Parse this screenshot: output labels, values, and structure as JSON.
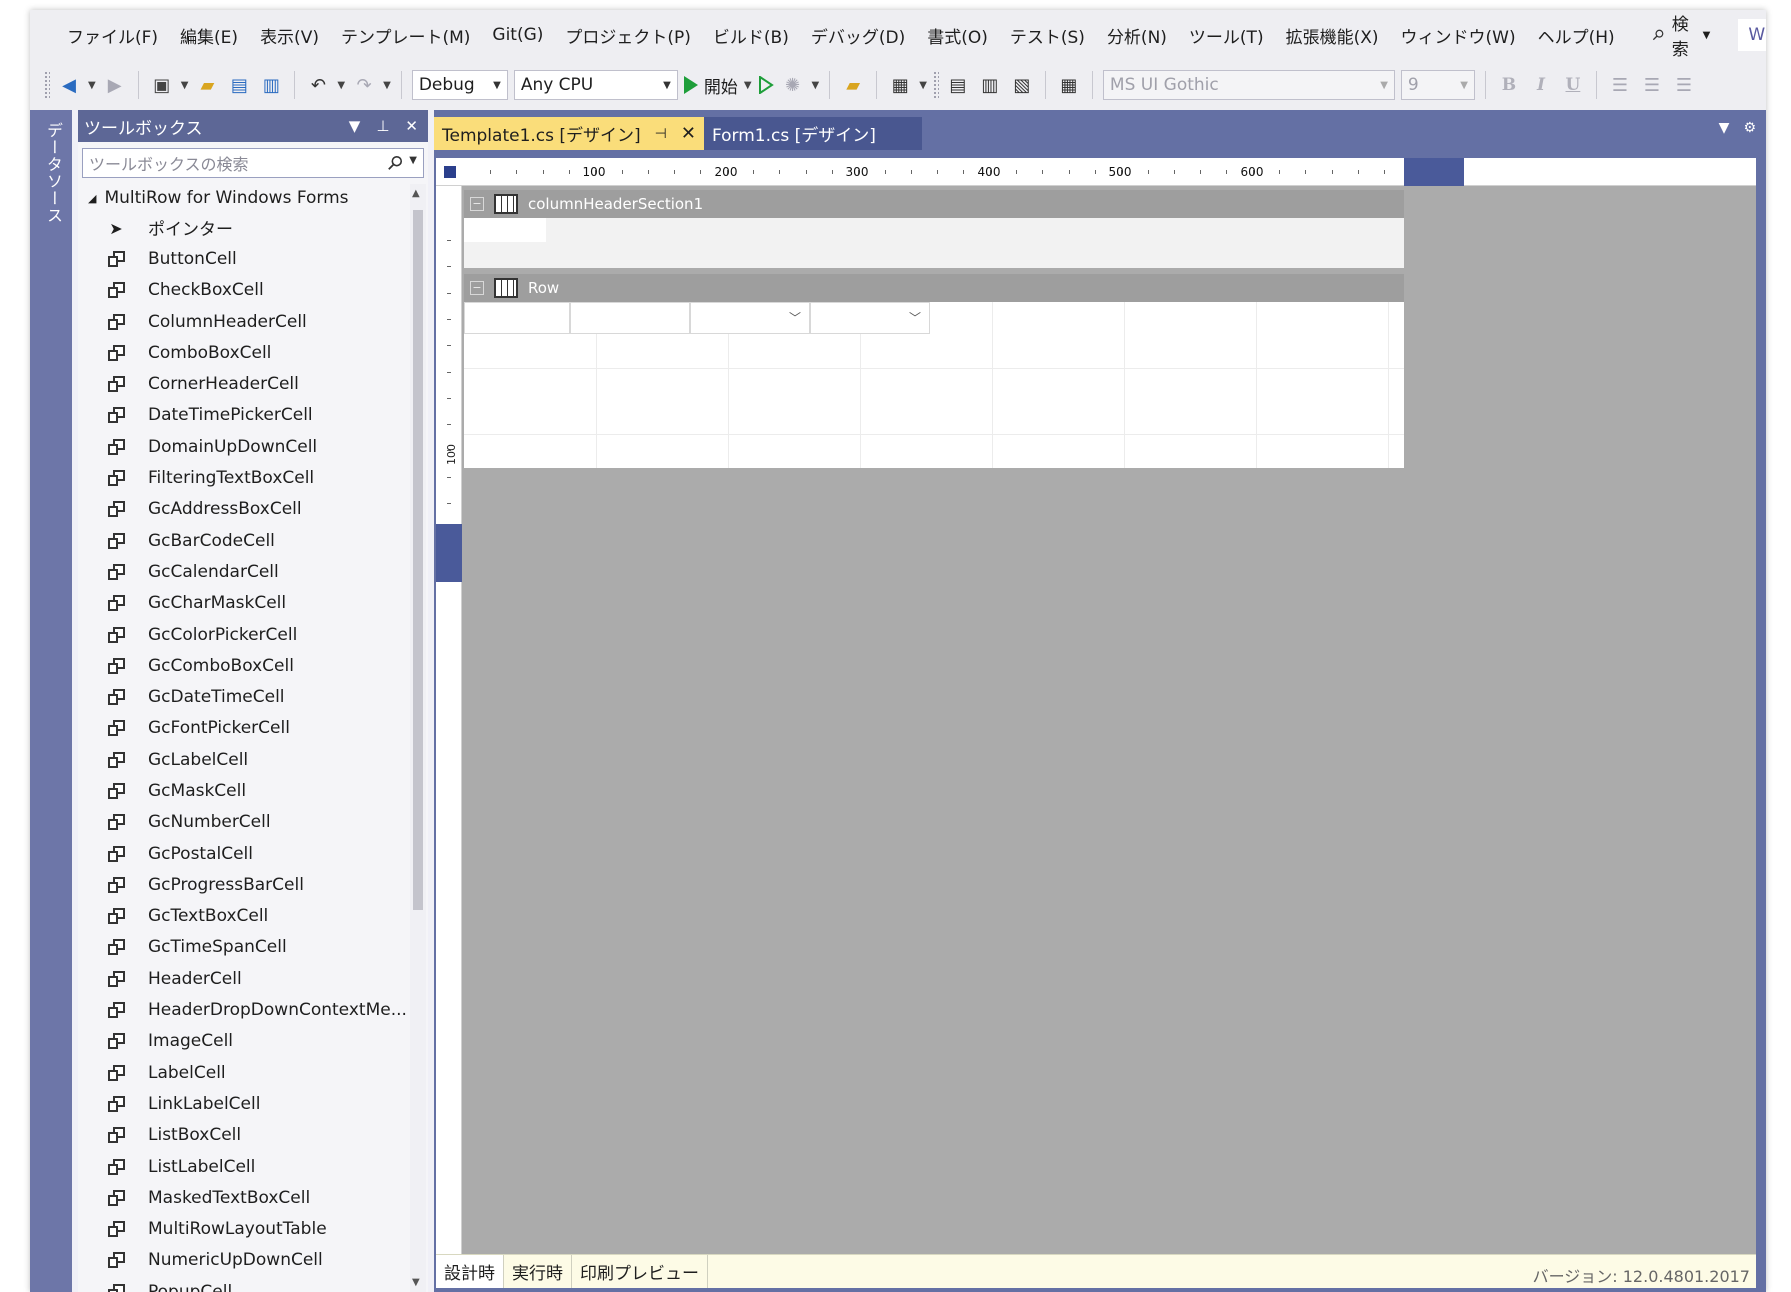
{
  "menu": {
    "items": [
      "ファイル(F)",
      "編集(E)",
      "表示(V)",
      "テンプレート(M)",
      "Git(G)",
      "プロジェクト(P)",
      "ビルド(B)",
      "デバッグ(D)",
      "書式(O)",
      "テスト(S)",
      "分析(N)",
      "ツール(T)",
      "拡張機能(X)",
      "ウィンドウ(W)",
      "ヘルプ(H)"
    ],
    "search_label": "検索",
    "window_tab": "Wi"
  },
  "toolbar": {
    "config": "Debug",
    "platform": "Any CPU",
    "start_label": "開始",
    "font_name": "MS UI Gothic",
    "font_size": "9",
    "bold": "B",
    "italic": "I",
    "underline": "U"
  },
  "side_strip": {
    "label": "データソース"
  },
  "toolbox": {
    "title": "ツールボックス",
    "search_placeholder": "ツールボックスの検索",
    "group": "MultiRow for Windows Forms",
    "pointer": "ポインター",
    "items": [
      "ButtonCell",
      "CheckBoxCell",
      "ColumnHeaderCell",
      "ComboBoxCell",
      "CornerHeaderCell",
      "DateTimePickerCell",
      "DomainUpDownCell",
      "FilteringTextBoxCell",
      "GcAddressBoxCell",
      "GcBarCodeCell",
      "GcCalendarCell",
      "GcCharMaskCell",
      "GcColorPickerCell",
      "GcComboBoxCell",
      "GcDateTimeCell",
      "GcFontPickerCell",
      "GcLabelCell",
      "GcMaskCell",
      "GcNumberCell",
      "GcPostalCell",
      "GcProgressBarCell",
      "GcTextBoxCell",
      "GcTimeSpanCell",
      "HeaderCell",
      "HeaderDropDownContextMe...",
      "ImageCell",
      "LabelCell",
      "LinkLabelCell",
      "ListBoxCell",
      "ListLabelCell",
      "MaskedTextBoxCell",
      "MultiRowLayoutTable",
      "NumericUpDownCell",
      "PopupCell"
    ]
  },
  "doc_tabs": {
    "active": "Template1.cs [デザイン]",
    "inactive": "Form1.cs [デザイン]"
  },
  "designer": {
    "ruler_labels": [
      "100",
      "200",
      "300",
      "400",
      "500",
      "600"
    ],
    "vruler_label": "100",
    "column_header_section": "columnHeaderSection1",
    "row_section": "Row"
  },
  "status": {
    "tabs": [
      "設計時",
      "実行時",
      "印刷プレビュー"
    ],
    "version": "バージョン: 12.0.4801.2017"
  },
  "colors": {
    "accent_tab": "#fadd7a",
    "toolbox_header": "#5d6796",
    "doc_bg": "#6470a4",
    "designer_bg": "#ababab"
  }
}
